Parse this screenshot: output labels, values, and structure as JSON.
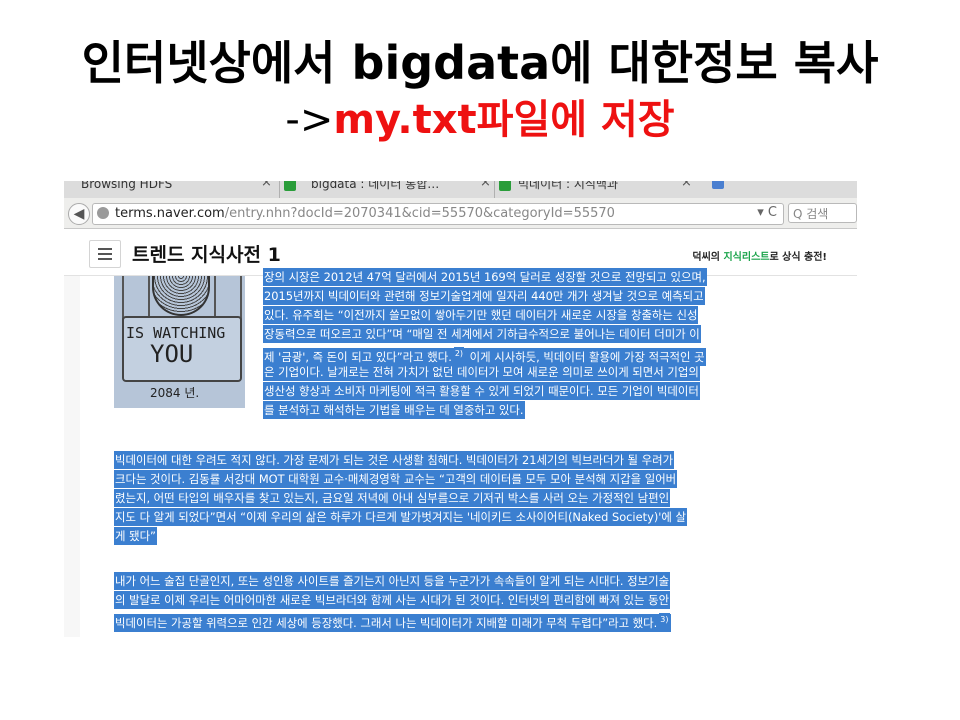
{
  "slide": {
    "title_line1": "인터넷상에서 bigdata에 대한정보 복사",
    "title_line2_prefix": "->",
    "title_line2_red": "my.txt파일에 저장"
  },
  "browser": {
    "tabs": [
      {
        "label": "Browsing HDFS",
        "close": "×"
      },
      {
        "label": "bigdata : 데이터 통합…",
        "close": "×"
      },
      {
        "label": "빅데이터 : 지식백과",
        "close": "×"
      }
    ],
    "url_host": "terms.naver.com",
    "url_path": "/entry.nhn?docId=2070341&cid=55570&categoryId=55570",
    "url_controls": "▾ C",
    "search_placeholder": "Q 검색",
    "back_arrow": "◀"
  },
  "page": {
    "title": "트렌드 지식사전 1",
    "promo_prefix": "덕씨의 ",
    "promo_green": "지식리스트",
    "promo_suffix": "로 상식 충전!",
    "image_text1": "IS WATCHING",
    "image_text2": "YOU",
    "image_text3": "2084 년.",
    "para1": [
      "장의 시장은 2012년 47억 달러에서 2015년 169억 달러로 성장할 것으로 전망되고 있으며,",
      "2015년까지 빅데이터와 관련해 정보기술업계에 일자리 440만 개가 생겨날 것으로 예측되고",
      "있다. 유주희는 “이전까지 쓸모없이 쌓아두기만 했던 데이터가 새로운 시장을 창출하는 신성",
      "장동력으로 떠오르고 있다”며 “매일 전 세계에서 기하급수적으로 불어나는 데이터 더미가 이",
      "제 '금광', 즉 돈이 되고 있다”라고 했다.",
      "은 기업이다. 날개로는 전혀 가치가 없던 데이터가 모여 새로운 의미로 쓰이게 되면서 기업의",
      "생산성 향상과 소비자 마케팅에 적극 활용할 수 있게 되었기 때문이다. 모든 기업이 빅데이터",
      "를 분석하고 해석하는 기법을 배우는 데 열중하고 있다."
    ],
    "para1_line5_sup": "2)",
    "para1_line5_tail": " 이게 시사하듯, 빅데이터 활용에 가장 적극적인 곳",
    "para2": [
      "빅데이터에 대한 우려도 적지 않다. 가장 문제가 되는 것은 사생활 침해다. 빅데이터가 21세기의 빅브라더가 될 우려가",
      "크다는 것이다. 김동률 서강대 MOT 대학원 교수·매체경영학 교수는 “고객의 데이터를 모두 모아 분석해 지갑을 일어버",
      "렸는지, 어떤 타입의 배우자를 찾고 있는지, 금요일 저녁에 아내 심부름으로 기저귀 박스를 사러 오는 가정적인 남편인",
      "지도 다 알게 되었다”면서 “이제 우리의 삶은 하루가 다르게 발가벗겨지는 '네이키드 소사이어티(Naked Society)'에 살",
      "게 됐다”"
    ],
    "para3": [
      "내가 어느 술집 단골인지, 또는 성인용 사이트를 즐기는지 아닌지 등을 누군가가 속속들이 알게 되는 시대다. 정보기술",
      "의 발달로 이제 우리는 어마어마한 새로운 빅브라더와 함께 사는 시대가 된 것이다. 인터넷의 편리함에 빠져 있는 동안",
      "빅데이터는 가공할 위력으로 인간 세상에 등장했다. 그래서 나는 빅데이터가 지배할 미래가 무척 두렵다”라고 했다."
    ],
    "para3_sup": "3)"
  },
  "colors": {
    "selection": "#3b7fd0",
    "title_red": "#ee1111",
    "promo_green": "#1aa34a"
  }
}
